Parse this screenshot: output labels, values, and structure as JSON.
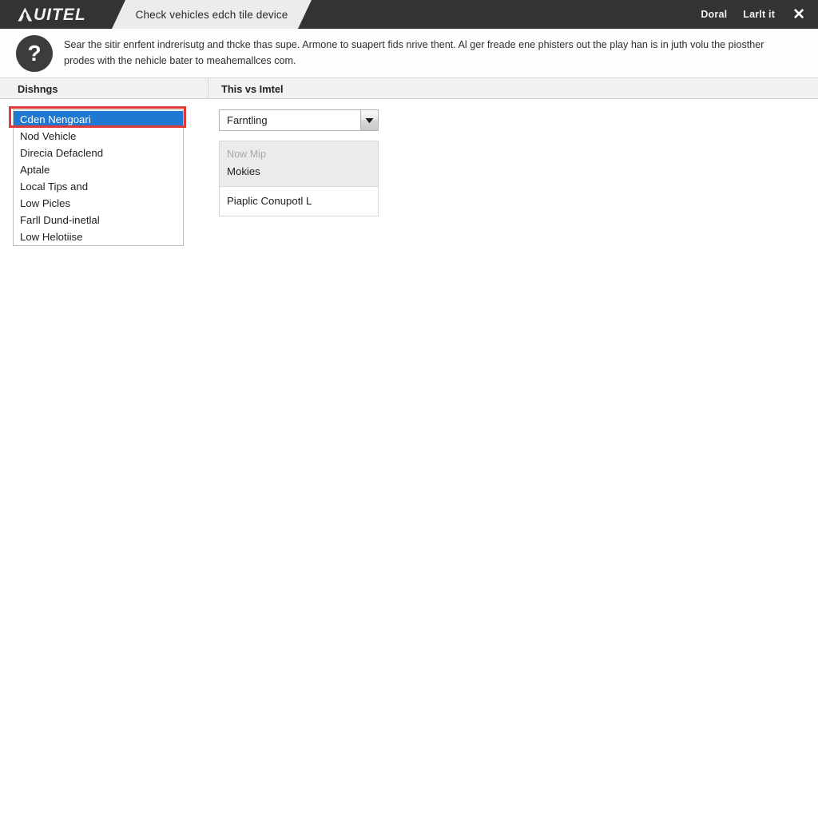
{
  "titlebar": {
    "brand": "UITEL",
    "brand_full": "AUITEL",
    "tab_label": "Check vehicles edch tile device",
    "actions": [
      {
        "label": "Doral",
        "name": "titlebar-link-doral"
      },
      {
        "label": "Larlt it",
        "name": "titlebar-link-larlt-it"
      }
    ],
    "close_glyph": "✕"
  },
  "help": {
    "icon_glyph": "?",
    "line1": "Sear the sitir enrfent indrerisutg and thcke thas supe. Armone to suapert fids nrive thent. Al ger freade ene phisters out the play han is in juth volu the piosther",
    "line2": "prodes with the nehicle bater to meahemallces com."
  },
  "columns": {
    "left_header": "Dishngs",
    "right_header": "This vs Imtel"
  },
  "left_list": {
    "selected_index": 0,
    "items": [
      "Cden Nengoari",
      "Nod Vehicle",
      "Direcia Defaclend",
      "Aptale",
      "Local Tips and",
      "Low Picles",
      "Farll Dund-inetlal",
      "Low Helotiise"
    ]
  },
  "right_panel": {
    "combo_value": "Farntling",
    "combo_arrow": "▼",
    "group_muted": "Now Mip",
    "group_strong": "Mokies",
    "bottom_item": "Piaplic Conupotl L"
  },
  "colors": {
    "titlebar_bg": "#333333",
    "tab_bg": "#ececec",
    "selection_blue": "#1f78d1",
    "focus_red": "#e03b3b",
    "help_icon_bg": "#3c3c3c"
  }
}
